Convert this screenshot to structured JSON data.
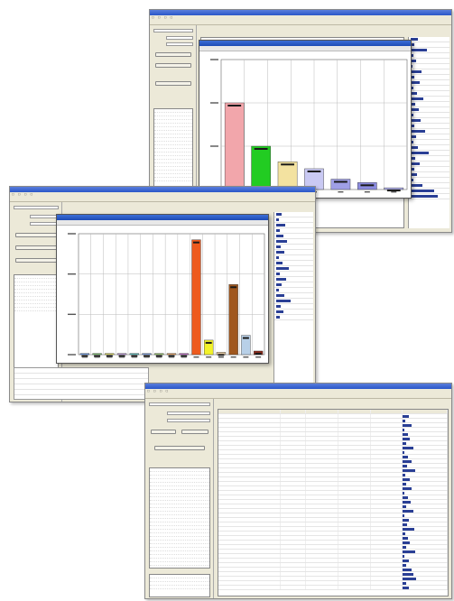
{
  "colors": {
    "titlebar": "#2a56c8",
    "window_bg": "#ece9d8",
    "bar_navy": "#2a3f95",
    "orange": "#ee5a1d",
    "brown": "#a0571e"
  },
  "win1": {
    "title": "",
    "chart": {
      "title": "",
      "caption": "",
      "bar_colors": [
        "#f2a6ab",
        "#22cc22",
        "#f3e2a0",
        "#c9c9f3",
        "#9f9fe6",
        "#8c8ce0",
        "#b2b2f0"
      ]
    }
  },
  "win2": {
    "title": "",
    "chart": {
      "title": "",
      "caption": "",
      "bar_colors": [
        "#6c9ff2",
        "#7ac96f",
        "#e9e35a",
        "#c9a0e8",
        "#55c3c3",
        "#7aa3ee",
        "#9bd06a",
        "#f2a35a",
        "#c86bd3",
        "#ee5a1d",
        "#f2f22a",
        "#e0c6a0",
        "#a0571e",
        "#b8d0e8",
        "#8b2a1a"
      ]
    }
  },
  "win3": {
    "title": ""
  },
  "chart_data": [
    {
      "type": "bar",
      "title": "",
      "categories": [
        "1",
        "2",
        "3",
        "4",
        "5",
        "6",
        "7"
      ],
      "values": [
        100,
        50,
        32,
        24,
        12,
        8,
        2
      ],
      "ylim": [
        0,
        150
      ],
      "grid": true,
      "xlabel": "",
      "ylabel": ""
    },
    {
      "type": "bar",
      "title": "",
      "categories": [
        "1",
        "2",
        "3",
        "4",
        "5",
        "6",
        "7",
        "8",
        "9",
        "10",
        "11",
        "12",
        "13",
        "14",
        "15"
      ],
      "values": [
        1,
        1,
        1,
        1,
        1,
        1,
        1,
        1,
        1,
        95,
        12,
        2,
        58,
        16,
        3
      ],
      "ylim": [
        0,
        100
      ],
      "grid": true,
      "xlabel": "",
      "ylabel": ""
    }
  ]
}
